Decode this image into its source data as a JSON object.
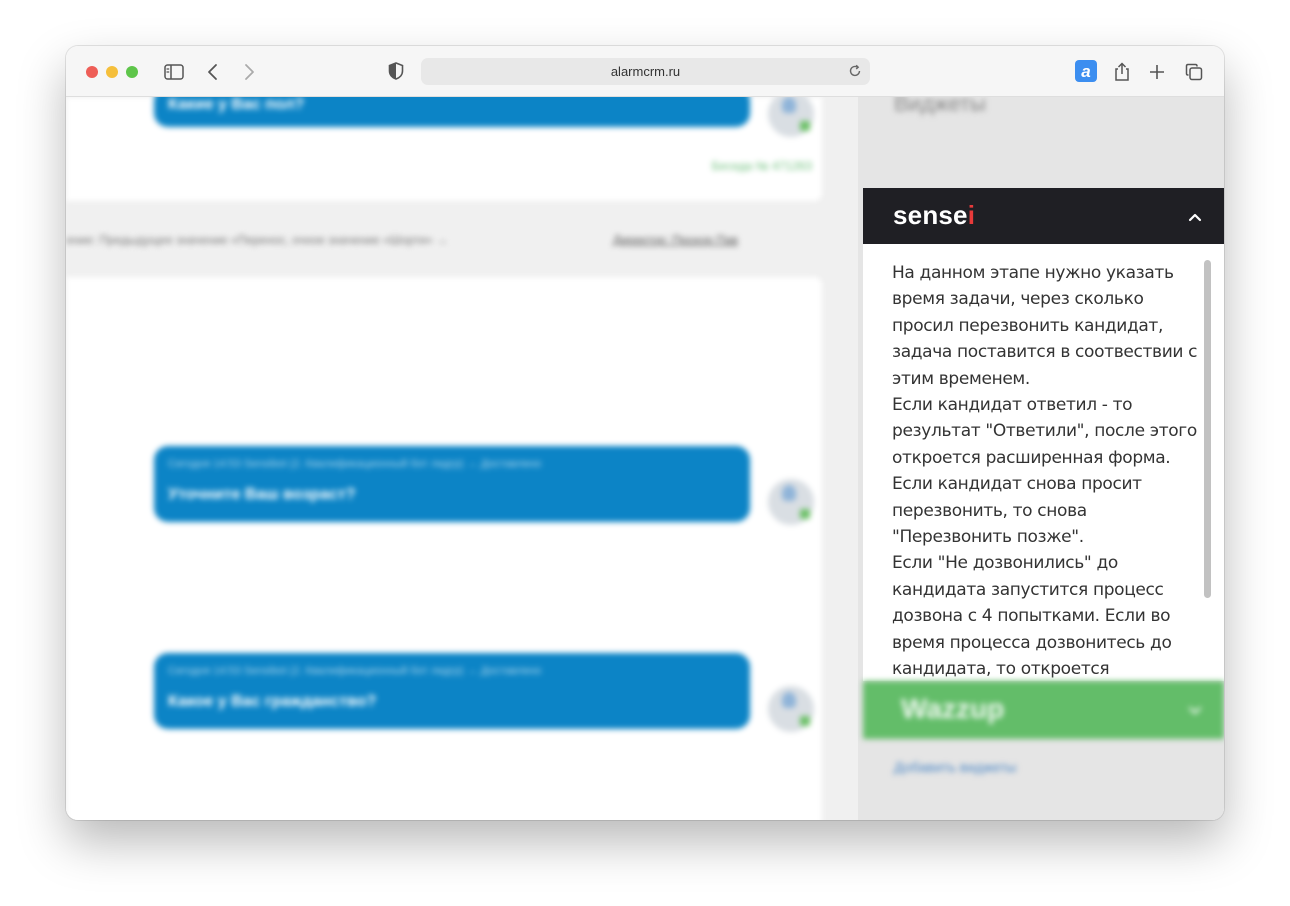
{
  "browser": {
    "url": "alarmcrm.ru"
  },
  "chat": {
    "top_bubble_text": "Какие у Вас пол?",
    "top_status": "Беседа № 471263",
    "system_line": "ение: Предыдущее значение «Перенос, очное значение «Шорти» →",
    "system_link": "Директор: Прохор Пав",
    "bubbles": [
      {
        "meta": "Сегодня 14:53 Sensibot (2. Квалификационный бот лидгр) → Доставлено",
        "msg": "Уточните Ваш возраст?"
      },
      {
        "meta": "Сегодня 14:53 Sensibot (2. Квалификационный бот лидгр) → Доставлено",
        "msg": "Какое у Вас гражданство?"
      }
    ]
  },
  "sidebar": {
    "widgets_title": "Виджеты",
    "sensei": {
      "logo_prefix": "sense",
      "logo_i": "i",
      "text": "На данном этапе нужно указать время задачи, через сколько просил перезвонить кандидат, задача поставится в соотвествии с этим временем.\nЕсли кандидат ответил - то результат \"Ответили\", после этого откроется расширенная форма.\nЕсли кандидат снова просит перезвонить, то снова \"Перезвонить позже\".\nЕсли \"Не дозвонились\" до кандидата запустится процесс дозвона с 4 попытками. Если во время процесса дозвонитесь до кандидата, то откроется"
    },
    "wazzup": {
      "title": "Wazzup"
    },
    "add_widgets": "Добавить виджеты"
  },
  "colors": {
    "bubble": "#0c84c6",
    "sensei_header": "#1f1f24",
    "sensei_accent": "#e83a3a",
    "wazzup": "#63bd69"
  }
}
